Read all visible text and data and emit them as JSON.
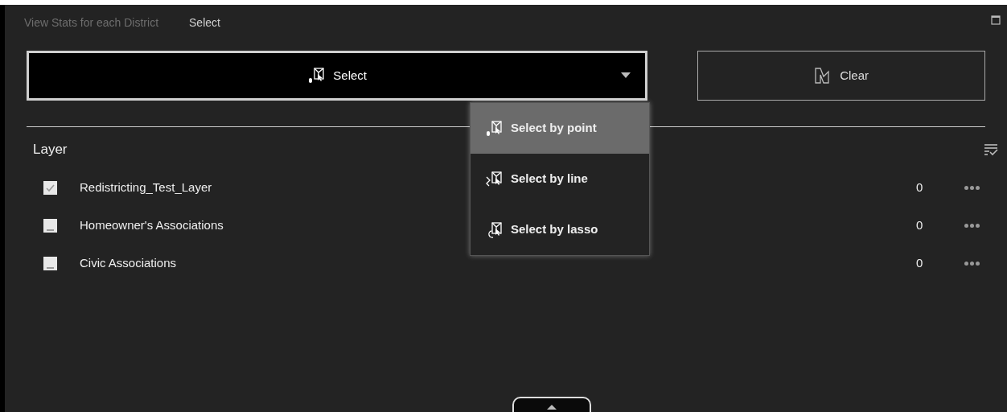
{
  "tabs": [
    {
      "label": "View Stats for each District",
      "selected": false
    },
    {
      "label": "Select",
      "selected": true
    }
  ],
  "select_button": {
    "label": "Select"
  },
  "select_menu": [
    {
      "label": "Select by point",
      "kind": "point",
      "selected": true
    },
    {
      "label": "Select by line",
      "kind": "line",
      "selected": false
    },
    {
      "label": "Select by lasso",
      "kind": "lasso",
      "selected": false
    }
  ],
  "clear_button": {
    "label": "Clear"
  },
  "layer_heading": "Layer",
  "layers": [
    {
      "name": "Redistricting_Test_Layer",
      "checked": true,
      "count": "0"
    },
    {
      "name": "Homeowner's Associations",
      "checked": false,
      "count": "0"
    },
    {
      "name": "Civic Associations",
      "checked": false,
      "count": "0"
    }
  ]
}
